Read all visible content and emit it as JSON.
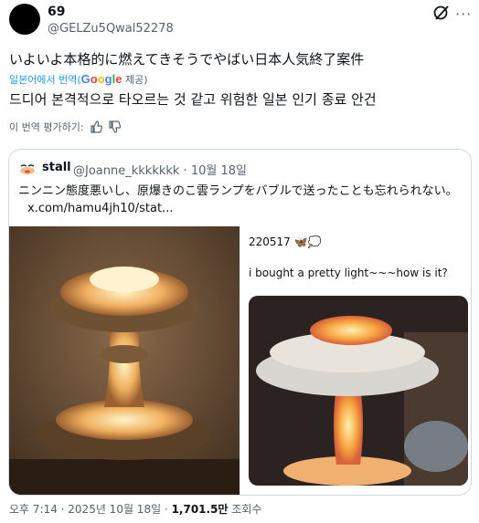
{
  "tweet": {
    "name": "69",
    "handle": "@GELZu5Qwal52278",
    "text_jp": "いよいよ本格的に燃えてきそうでやばい日本人気終了案件",
    "translated_from": "일본어에서 번역(",
    "google": "Google",
    "provided": " 제공)",
    "text_ko": "드디어 본격적으로 타오르는 것 같고 위험한 일본 인기 종료 안건",
    "rate_label": "이 번역 평가하기:"
  },
  "quote": {
    "name": "stall",
    "meta": "@Joanne_kkkkkkk · 10월 18일",
    "text": "ニンニン態度悪いし、原爆きのこ雲ランプをバブルで送ったことも忘れられない。",
    "link": "x.com/hamu4jh10/stat...",
    "card": {
      "line1": "220517 🦋💭",
      "line2": "i bought a pretty light~~~how is it?"
    }
  },
  "footer": {
    "time": "오후 7:14 · 2025년 10월 18일 · ",
    "views": "1,701.5만",
    "views_label": " 조회수"
  }
}
